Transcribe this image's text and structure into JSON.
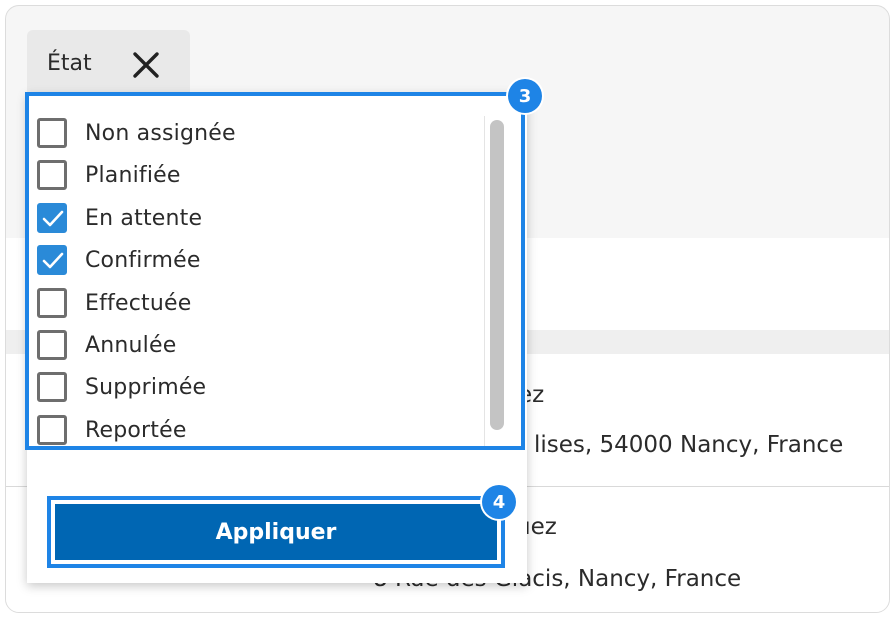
{
  "filter_chip": {
    "label": "État",
    "close_icon": "close-icon"
  },
  "background_rows": [
    {
      "name_fragment": "ez",
      "address_fragment": "lises, 54000 Nancy, France"
    },
    {
      "name_fragment": "uez",
      "address_fragment": "8 Rue des Glacis, Nancy, France"
    }
  ],
  "status_options": [
    {
      "label": "Non assignée",
      "checked": false
    },
    {
      "label": "Planifiée",
      "checked": false
    },
    {
      "label": "En attente",
      "checked": true
    },
    {
      "label": "Confirmée",
      "checked": true
    },
    {
      "label": "Effectuée",
      "checked": false
    },
    {
      "label": "Annulée",
      "checked": false
    },
    {
      "label": "Supprimée",
      "checked": false
    },
    {
      "label": "Reportée",
      "checked": false
    }
  ],
  "annotations": {
    "list_badge": "3",
    "apply_badge": "4"
  },
  "apply_button": {
    "label": "Appliquer"
  },
  "colors": {
    "accent": "#1e84e6",
    "button": "#0066b3",
    "checkbox_checked": "#2a8ad8"
  }
}
